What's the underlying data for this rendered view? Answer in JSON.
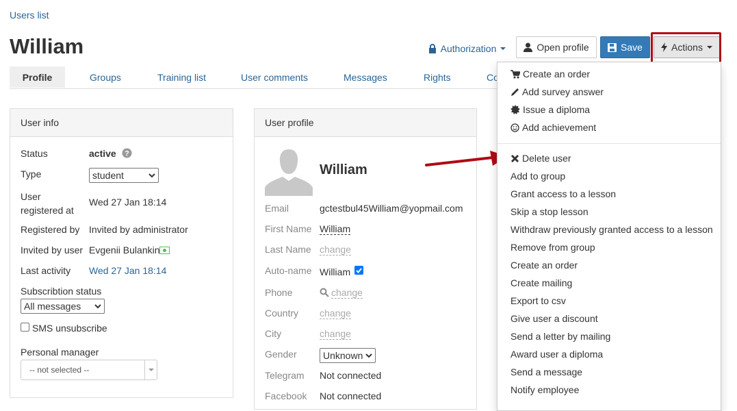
{
  "breadcrumb": "Users list",
  "page_title": "William",
  "header_buttons": {
    "authorization": "Authorization",
    "open_profile": "Open profile",
    "save": "Save",
    "actions": "Actions"
  },
  "tabs": [
    "Profile",
    "Groups",
    "Training list",
    "User comments",
    "Messages",
    "Rights",
    "Co"
  ],
  "user_info": {
    "title": "User info",
    "status_label": "Status",
    "status_value": "active",
    "type_label": "Type",
    "type_value": "student",
    "registered_label": "User registered at",
    "registered_value": "Wed 27 Jan 18:14",
    "registered_by_label": "Registered by",
    "registered_by_value": "Invited by administrator",
    "invited_by_label": "Invited by user",
    "invited_by_value": "Evgenii Bulankin",
    "last_activity_label": "Last activity",
    "last_activity_value": "Wed 27 Jan 18:14",
    "subscription_label": "Subscribtion status",
    "subscription_value": "All messages",
    "sms_label": "SMS unsubscribe",
    "manager_label": "Personal manager",
    "manager_value": "-- not selected --"
  },
  "user_profile": {
    "title": "User profile",
    "name": "William",
    "email_label": "Email",
    "email_value": "gctestbul45William@yopmail.com",
    "first_name_label": "First Name",
    "first_name_value": "William",
    "last_name_label": "Last Name",
    "last_name_value": "change",
    "autoname_label": "Auto-name",
    "autoname_value": "William",
    "phone_label": "Phone",
    "phone_value": "change",
    "country_label": "Country",
    "country_value": "change",
    "city_label": "City",
    "city_value": "change",
    "gender_label": "Gender",
    "gender_value": "Unknown",
    "telegram_label": "Telegram",
    "telegram_value": "Not connected",
    "facebook_label": "Facebook",
    "facebook_value": "Not connected"
  },
  "actions_menu": {
    "top_items": [
      "Create an order",
      "Add survey answer",
      "Issue a diploma",
      "Add achievement"
    ],
    "items": [
      "Delete user",
      "Add to group",
      "Grant access to a lesson",
      "Skip a stop lesson",
      "Withdraw previously granted access to a lesson",
      "Remove from group",
      "Create an order",
      "Create mailing",
      "Export to csv",
      "Give user a discount",
      "Send a letter by mailing",
      "Award user a diploma",
      "Send a message",
      "Notify employee"
    ]
  },
  "colors": {
    "link": "#2a6496",
    "primary": "#337ab7",
    "highlight": "#b00b14"
  }
}
